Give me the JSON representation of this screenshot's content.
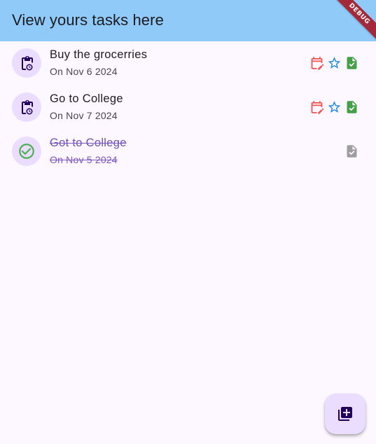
{
  "appbar": {
    "title": "View yours tasks here",
    "background": "#90caf9",
    "debug_label": "DEBUG"
  },
  "tasks": [
    {
      "title": "Buy the grocerries",
      "date": "On Nov 6 2024",
      "status": "pending",
      "leading_icon": "clipboard-clock-icon",
      "actions": [
        "edit-calendar-icon",
        "star-outline-icon",
        "task-done-icon"
      ]
    },
    {
      "title": "Go to College",
      "date": "On Nov 7 2024",
      "status": "pending",
      "leading_icon": "clipboard-clock-icon",
      "actions": [
        "edit-calendar-icon",
        "star-outline-icon",
        "task-done-icon"
      ]
    },
    {
      "title": "Got to College",
      "date": "On Nov 5 2024",
      "status": "completed",
      "leading_icon": "check-circle-icon",
      "actions": [
        "task-done-icon"
      ]
    }
  ],
  "fab": {
    "icon": "add-to-library-icon"
  },
  "colors": {
    "background": "#fdf7ff",
    "avatar": "#eaddff",
    "calendar_red": "#ef5350",
    "star_blue": "#1e88e5",
    "task_green": "#43a047",
    "task_grey": "#9e9e9e",
    "check_green": "#4caf50",
    "strike_purple": "#7e57c2"
  }
}
